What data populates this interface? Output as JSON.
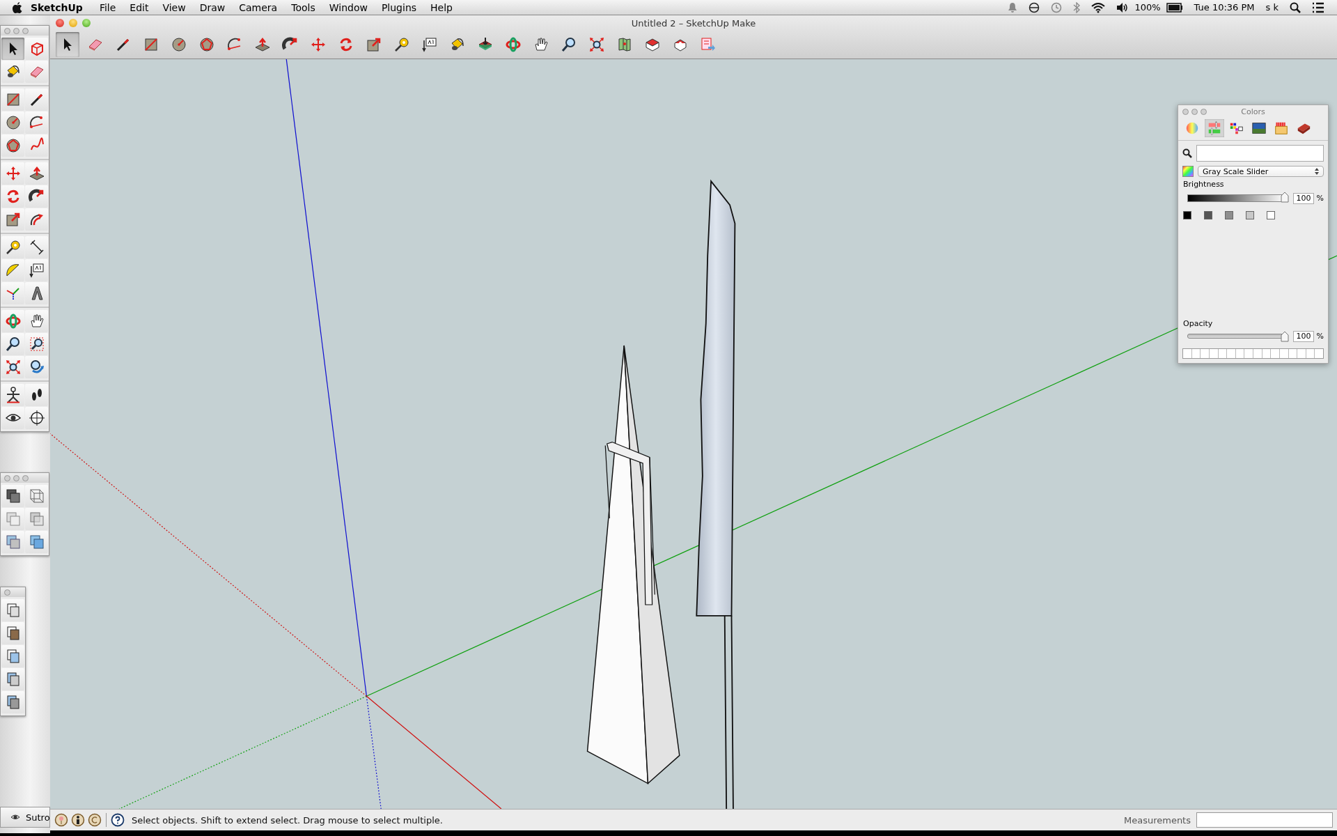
{
  "menu_bar": {
    "app_name": "SketchUp",
    "menus": [
      "File",
      "Edit",
      "View",
      "Draw",
      "Camera",
      "Tools",
      "Window",
      "Plugins",
      "Help"
    ],
    "battery": "100%",
    "clock": "Tue 10:36 PM",
    "user": "s k"
  },
  "window": {
    "title": "Untitled 2 – SketchUp Make"
  },
  "main_toolbar": {
    "tools": [
      {
        "kind": "select",
        "selected": true
      },
      {
        "kind": "eraser",
        "selected": false
      },
      {
        "kind": "pencil",
        "selected": false
      },
      {
        "kind": "rectangle",
        "selected": false
      },
      {
        "kind": "circle",
        "selected": false
      },
      {
        "kind": "polygon",
        "selected": false
      },
      {
        "kind": "arc",
        "selected": false
      },
      {
        "kind": "pushpull",
        "selected": false
      },
      {
        "kind": "followme",
        "selected": false
      },
      {
        "kind": "move",
        "selected": false
      },
      {
        "kind": "rotate",
        "selected": false
      },
      {
        "kind": "scale",
        "selected": false
      },
      {
        "kind": "tape",
        "selected": false
      },
      {
        "kind": "text",
        "selected": false
      },
      {
        "kind": "paint",
        "selected": false
      },
      {
        "kind": "section",
        "selected": false
      },
      {
        "kind": "orbit",
        "selected": false
      },
      {
        "kind": "pan",
        "selected": false
      },
      {
        "kind": "zoom",
        "selected": false
      },
      {
        "kind": "zoomextents",
        "selected": false
      },
      {
        "kind": "map",
        "selected": false
      },
      {
        "kind": "warehouse",
        "selected": false
      },
      {
        "kind": "share",
        "selected": false
      },
      {
        "kind": "layout",
        "selected": false
      }
    ]
  },
  "large_tool_set": {
    "groups": [
      {
        "tools": [
          {
            "kind": "select",
            "selected": true
          },
          {
            "kind": "component",
            "selected": false
          },
          {
            "kind": "paint",
            "selected": false
          },
          {
            "kind": "eraser",
            "selected": false
          }
        ]
      },
      {
        "tools": [
          {
            "kind": "rectangle",
            "selected": false
          },
          {
            "kind": "pencil",
            "selected": false
          },
          {
            "kind": "circle",
            "selected": false
          },
          {
            "kind": "arc",
            "selected": false
          },
          {
            "kind": "polygon",
            "selected": false
          },
          {
            "kind": "freehand",
            "selected": false
          }
        ]
      },
      {
        "tools": [
          {
            "kind": "move",
            "selected": false
          },
          {
            "kind": "pushpull",
            "selected": false
          },
          {
            "kind": "rotate",
            "selected": false
          },
          {
            "kind": "followme",
            "selected": false
          },
          {
            "kind": "scale",
            "selected": false
          },
          {
            "kind": "offset",
            "selected": false
          }
        ]
      },
      {
        "tools": [
          {
            "kind": "tape",
            "selected": false
          },
          {
            "kind": "dimension",
            "selected": false
          },
          {
            "kind": "protractor",
            "selected": false
          },
          {
            "kind": "text",
            "selected": false
          },
          {
            "kind": "axes",
            "selected": false
          },
          {
            "kind": "text3d",
            "selected": false
          }
        ]
      },
      {
        "tools": [
          {
            "kind": "orbit",
            "selected": false
          },
          {
            "kind": "pan",
            "selected": false
          },
          {
            "kind": "zoom",
            "selected": false
          },
          {
            "kind": "zoomwindow",
            "selected": false
          },
          {
            "kind": "zoomextents",
            "selected": false
          },
          {
            "kind": "previous",
            "selected": false
          }
        ]
      },
      {
        "tools": [
          {
            "kind": "walk",
            "selected": false
          },
          {
            "kind": "footprints",
            "selected": false
          },
          {
            "kind": "eye",
            "selected": false
          },
          {
            "kind": "position",
            "selected": false
          }
        ]
      }
    ]
  },
  "face_style_palette": {
    "tools": [
      {
        "kind": "shaded",
        "selected": false
      },
      {
        "kind": "wireframe",
        "selected": false
      },
      {
        "kind": "hiddenline",
        "selected": false
      },
      {
        "kind": "xray",
        "selected": false
      },
      {
        "kind": "monochrome",
        "selected": false
      },
      {
        "kind": "textured",
        "selected": false
      }
    ]
  },
  "views_palette": {
    "tools": [
      {
        "kind": "iso",
        "selected": false
      },
      {
        "kind": "top",
        "selected": false
      },
      {
        "kind": "front",
        "selected": false
      },
      {
        "kind": "right",
        "selected": false
      },
      {
        "kind": "back",
        "selected": false
      }
    ]
  },
  "background_window": {
    "title": "Sutro"
  },
  "colors_panel": {
    "title": "Colors",
    "tabs": [
      {
        "kind": "wheel",
        "selected": false
      },
      {
        "kind": "sliders",
        "selected": true
      },
      {
        "kind": "palettes",
        "selected": false
      },
      {
        "kind": "image",
        "selected": false
      },
      {
        "kind": "crayons",
        "selected": false
      },
      {
        "kind": "brick",
        "selected": false
      }
    ],
    "mode": "Gray Scale Slider",
    "brightness": {
      "label": "Brightness",
      "level": 1,
      "value": "100",
      "unit": "%"
    },
    "swatches": [
      {
        "color": "#000000"
      },
      {
        "color": "#555555"
      },
      {
        "color": "#8e8e8e"
      },
      {
        "color": "#c8c8c8"
      },
      {
        "color": "#ffffff"
      }
    ],
    "opacity": {
      "label": "Opacity",
      "level": 1,
      "value": "100",
      "unit": "%"
    }
  },
  "status_bar": {
    "message": "Select objects. Shift to extend select. Drag mouse to select multiple.",
    "measurements_label": "Measurements"
  }
}
